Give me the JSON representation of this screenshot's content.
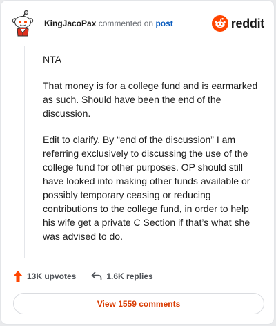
{
  "comment": {
    "username": "KingJacoPax",
    "action": "commented on",
    "link_text": "post",
    "brand": "reddit",
    "paragraphs": [
      "NTA",
      "That money is for a college fund and is earmarked as such. Should have been the end of the discussion.",
      "Edit to clarify. By “end of the discussion” I am referring exclusively to discussing the use of the college fund for other purposes. OP should still have looked into making other funds available or possibly temporary ceasing or reducing contributions to the college fund, in order to help his wife get a private C Section if that’s what she was advised to do."
    ],
    "upvotes": "13K upvotes",
    "replies": "1.6K replies",
    "view_comments": "View 1559 comments"
  },
  "icons": {
    "avatar": "snoo-avatar-icon",
    "logo": "reddit-logo-icon",
    "upvote": "upvote-arrow-icon",
    "reply": "reply-arrow-icon"
  },
  "colors": {
    "brand_orange": "#ff4500",
    "link_blue": "#0b5dbf",
    "action_orange": "#d93a00"
  }
}
